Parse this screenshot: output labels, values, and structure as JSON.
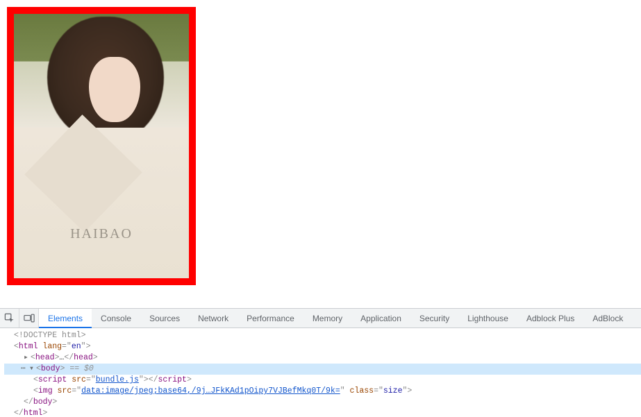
{
  "page": {
    "watermark": "HAIBAO",
    "image_border_color": "#ff0000"
  },
  "devtools": {
    "toolbar": {
      "inspect_icon": "inspect",
      "device_icon": "device"
    },
    "tabs": [
      {
        "label": "Elements",
        "active": true
      },
      {
        "label": "Console",
        "active": false
      },
      {
        "label": "Sources",
        "active": false
      },
      {
        "label": "Network",
        "active": false
      },
      {
        "label": "Performance",
        "active": false
      },
      {
        "label": "Memory",
        "active": false
      },
      {
        "label": "Application",
        "active": false
      },
      {
        "label": "Security",
        "active": false
      },
      {
        "label": "Lighthouse",
        "active": false
      },
      {
        "label": "Adblock Plus",
        "active": false
      },
      {
        "label": "AdBlock",
        "active": false
      }
    ],
    "dom": {
      "doctype": "<!DOCTYPE html>",
      "html_open": {
        "tag": "html",
        "attrs": [
          {
            "name": "lang",
            "value": "en"
          }
        ]
      },
      "head": {
        "tag": "head",
        "collapsed_ellipsis": "…"
      },
      "body_open": {
        "tag": "body",
        "selected_marker": "== $0"
      },
      "script": {
        "tag": "script",
        "attrs": [
          {
            "name": "src",
            "value": "bundle.js",
            "link": true
          }
        ]
      },
      "img": {
        "tag": "img",
        "attrs": [
          {
            "name": "src",
            "value": "data:image/jpeg;base64,/9j…JFkKAd1pOipy7VJBefMkq0T/9k=",
            "link": true
          },
          {
            "name": "class",
            "value": "size"
          }
        ]
      },
      "body_close": "</body>",
      "html_close": "</html>"
    }
  }
}
